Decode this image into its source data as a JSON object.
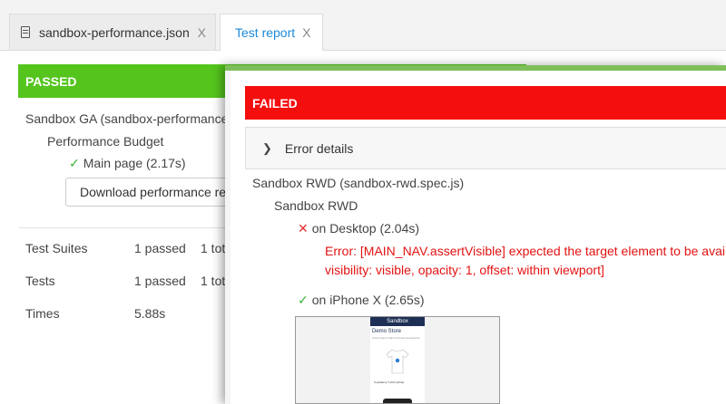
{
  "tabs": [
    {
      "label": "sandbox-performance.json",
      "close": "X"
    },
    {
      "label": "Test report",
      "close": "X"
    }
  ],
  "background_report": {
    "status": "PASSED",
    "suite": "Sandbox GA (sandbox-performance",
    "group": "Performance Budget",
    "test": "Main page (2.17s)",
    "download_button": "Download performance re",
    "stats": [
      {
        "label": "Test Suites",
        "value": "1 passed",
        "extra": "1 tot"
      },
      {
        "label": "Tests",
        "value": "1 passed",
        "extra": "1 tot"
      },
      {
        "label": "Times",
        "value": "5.88s",
        "extra": ""
      }
    ]
  },
  "overlay": {
    "status": "FAILED",
    "error_details": "Error details",
    "suite": "Sandbox RWD (sandbox-rwd.spec.js)",
    "group": "Sandbox RWD",
    "failed_test": "on Desktop (2.04s)",
    "error_line1": "Error: [MAIN_NAV.assertVisible] expected the target element to be avai",
    "error_line2": "visibility: visible, opacity: 1, offset: within viewport]",
    "passed_test": "on iPhone X (2.65s)",
    "screenshot": {
      "header": "Sandbox",
      "title": "Demo Store",
      "subtitle": "Lorem ipsum dolor sit amet consectetur",
      "caption": "Cupcakery T-shirt (white)"
    }
  },
  "colors": {
    "passed": "#55c51d",
    "failed": "#f50e0e",
    "active_tab": "#1a8ad8"
  }
}
